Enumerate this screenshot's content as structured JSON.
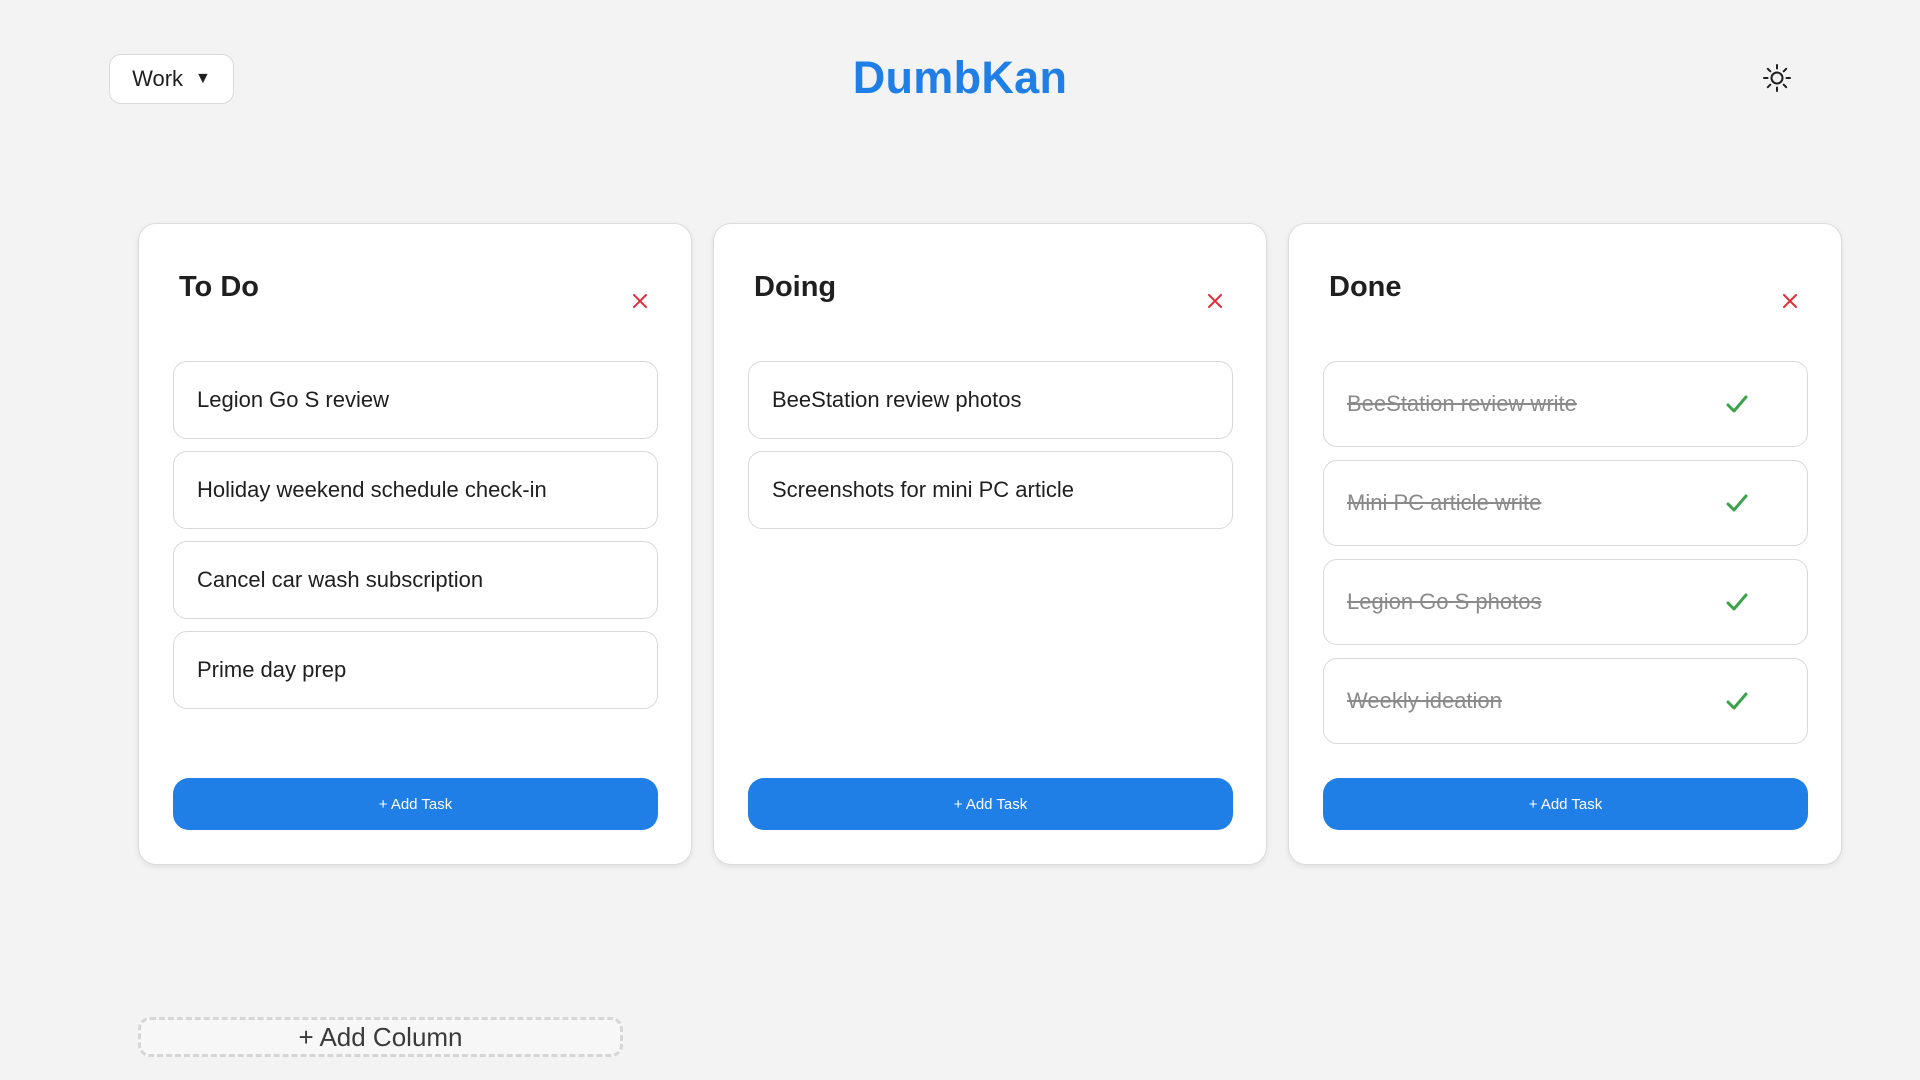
{
  "header": {
    "board_name": "Work",
    "board_caret": "▼",
    "app_title": "DumbKan",
    "theme_icon": "sun-icon"
  },
  "colors": {
    "accent": "#1f7fe6",
    "delete": "#e0303a",
    "check": "#3aa34a",
    "background": "#f3f3f3"
  },
  "columns": [
    {
      "title": "To Do",
      "tasks": [
        {
          "text": "Legion Go S review"
        },
        {
          "text": "Holiday weekend schedule check-in"
        },
        {
          "text": "Cancel car wash subscription"
        },
        {
          "text": "Prime day prep"
        }
      ],
      "add_task_label": "+ Add Task"
    },
    {
      "title": "Doing",
      "tasks": [
        {
          "text": "BeeStation review photos"
        },
        {
          "text": "Screenshots for mini PC article"
        }
      ],
      "add_task_label": "+ Add Task"
    },
    {
      "title": "Done",
      "tasks": [
        {
          "text": "BeeStation review write",
          "completed": true
        },
        {
          "text": "Mini PC article write",
          "completed": true
        },
        {
          "text": "Legion Go S photos",
          "completed": true
        },
        {
          "text": "Weekly ideation",
          "completed": true
        }
      ],
      "add_task_label": "+ Add Task"
    }
  ],
  "add_column_label": "+ Add Column"
}
